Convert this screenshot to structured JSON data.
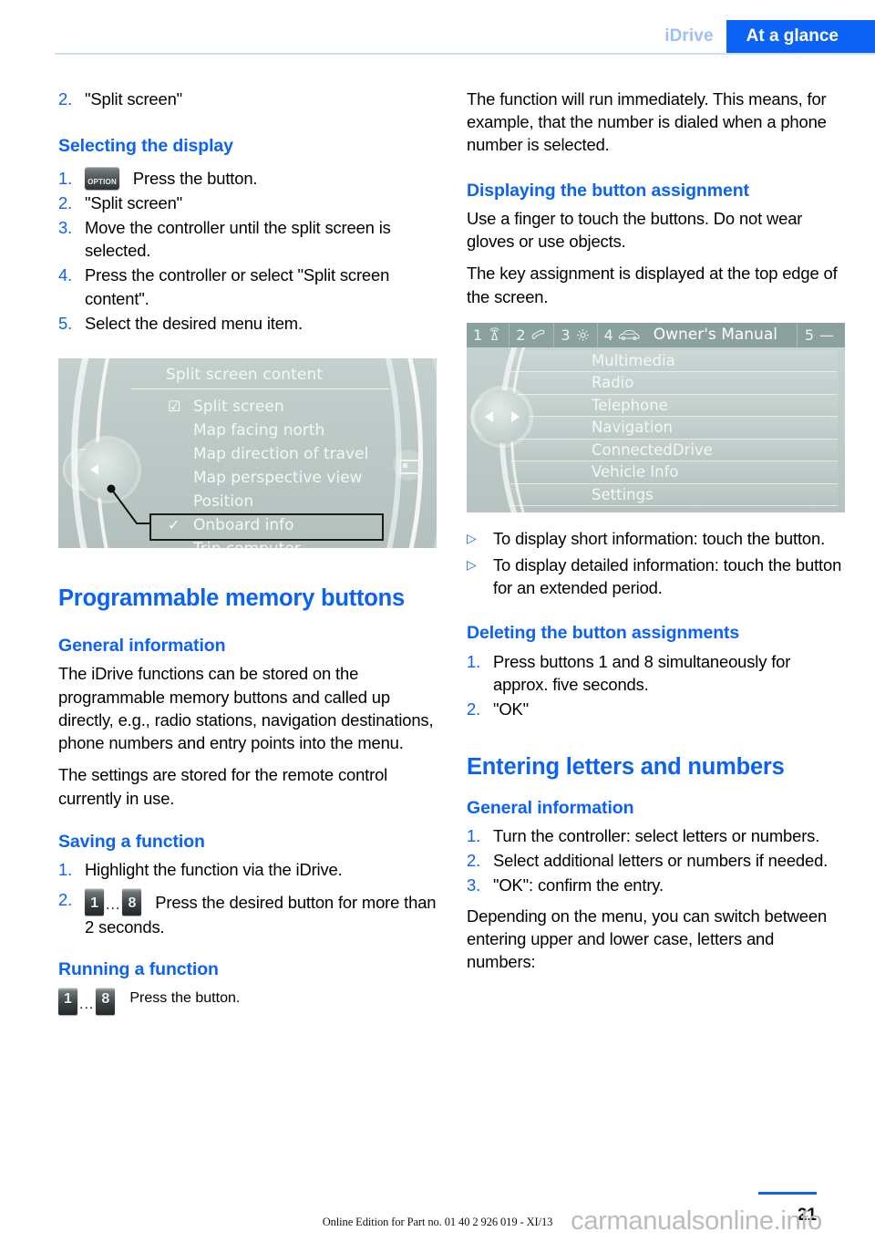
{
  "header": {
    "chapter": "iDrive",
    "section": "At a glance"
  },
  "left_column": {
    "step_top": {
      "num": "2.",
      "text": "\"Split screen\""
    },
    "heading_selecting_display": "Selecting the display",
    "selecting_display_steps": [
      {
        "num": "1.",
        "icon": "option-button-icon",
        "icon_label": "OPTION",
        "text": "Press the button."
      },
      {
        "num": "2.",
        "text": "\"Split screen\""
      },
      {
        "num": "3.",
        "text": "Move the controller until the split screen is selected."
      },
      {
        "num": "4.",
        "text": "Press the controller or select \"Split screen content\"."
      },
      {
        "num": "5.",
        "text": "Select the desired menu item."
      }
    ],
    "split_screen_image": {
      "title": "Split screen content",
      "items": [
        {
          "label": "Split screen",
          "mark": "checkbox-checked",
          "highlighted": false
        },
        {
          "label": "Map facing north",
          "mark": "",
          "highlighted": false
        },
        {
          "label": "Map direction of travel",
          "mark": "",
          "highlighted": false
        },
        {
          "label": "Map perspective view",
          "mark": "",
          "highlighted": false
        },
        {
          "label": "Position",
          "mark": "",
          "highlighted": false
        },
        {
          "label": "Onboard info",
          "mark": "check",
          "highlighted": true
        },
        {
          "label": "Trip computer",
          "mark": "",
          "highlighted": false
        }
      ]
    },
    "heading_programmable": "Programmable memory buttons",
    "heading_general_information": "General information",
    "paragraph_1": "The iDrive functions can be stored on the programmable memory buttons and called up directly, e.g., radio stations, navigation destinations, phone numbers and entry points into the menu.",
    "paragraph_2": "The settings are stored for the remote control currently in use.",
    "heading_saving": "Saving a function",
    "saving_steps": [
      {
        "num": "1.",
        "text": "Highlight the function via the iDrive."
      },
      {
        "num": "2.",
        "keys": [
          "1",
          "8"
        ],
        "dots": "...",
        "text": "Press the desired button for more than 2 seconds."
      }
    ],
    "heading_running": "Running a function",
    "running": {
      "keys": [
        "1",
        "8"
      ],
      "dots": "...",
      "text": "Press the button."
    }
  },
  "right_column": {
    "paragraph_1": "The function will run immediately. This means, for example, that the number is dialed when a phone number is selected.",
    "heading_displaying": "Displaying the button assignment",
    "paragraph_2": "Use a finger to touch the buttons. Do not wear gloves or use objects.",
    "paragraph_3": "The key assignment is displayed at the top edge of the screen.",
    "owners_manual_image": {
      "topbar": [
        {
          "num": "1",
          "icon": "radio-antenna-icon"
        },
        {
          "num": "2",
          "icon": "phone-handset-icon"
        },
        {
          "num": "3",
          "icon": "gear-icon"
        },
        {
          "num": "4",
          "icon": "car-icon"
        }
      ],
      "title": "Owner's Manual",
      "right_slot": {
        "num": "5",
        "icon": "dash-icon",
        "dash": "—"
      },
      "rows": [
        "Multimedia",
        "Radio",
        "Telephone",
        "Navigation",
        "ConnectedDrive",
        "Vehicle Info",
        "Settings"
      ]
    },
    "bullets": [
      {
        "marker": "▷",
        "text": "To display short information: touch the button."
      },
      {
        "marker": "▷",
        "text": "To display detailed information: touch the button for an extended period."
      }
    ],
    "heading_deleting": "Deleting the button assignments",
    "deleting_steps": [
      {
        "num": "1.",
        "text": "Press buttons 1 and 8 simultaneously for approx. five seconds."
      },
      {
        "num": "2.",
        "text": "\"OK\""
      }
    ],
    "heading_entering": "Entering letters and numbers",
    "heading_general_information": "General information",
    "entering_steps": [
      {
        "num": "1.",
        "text": "Turn the controller: select letters or numbers."
      },
      {
        "num": "2.",
        "text": "Select additional letters or numbers if needed."
      },
      {
        "num": "3.",
        "text": "\"OK\": confirm the entry."
      }
    ],
    "paragraph_4": "Depending on the menu, you can switch between entering upper and lower case, letters and numbers:"
  },
  "footer": {
    "edition": "Online Edition for Part no. 01 40 2 926 019 - XI/13",
    "page_number": "21",
    "watermark": "carmanualsonline.info"
  },
  "colors": {
    "accent_blue": "#0b62f4",
    "header_chapter_blue": "#9fc0f5",
    "idrive_bg": "#bcc9c7",
    "idrive_topbar": "#8ba19d"
  }
}
